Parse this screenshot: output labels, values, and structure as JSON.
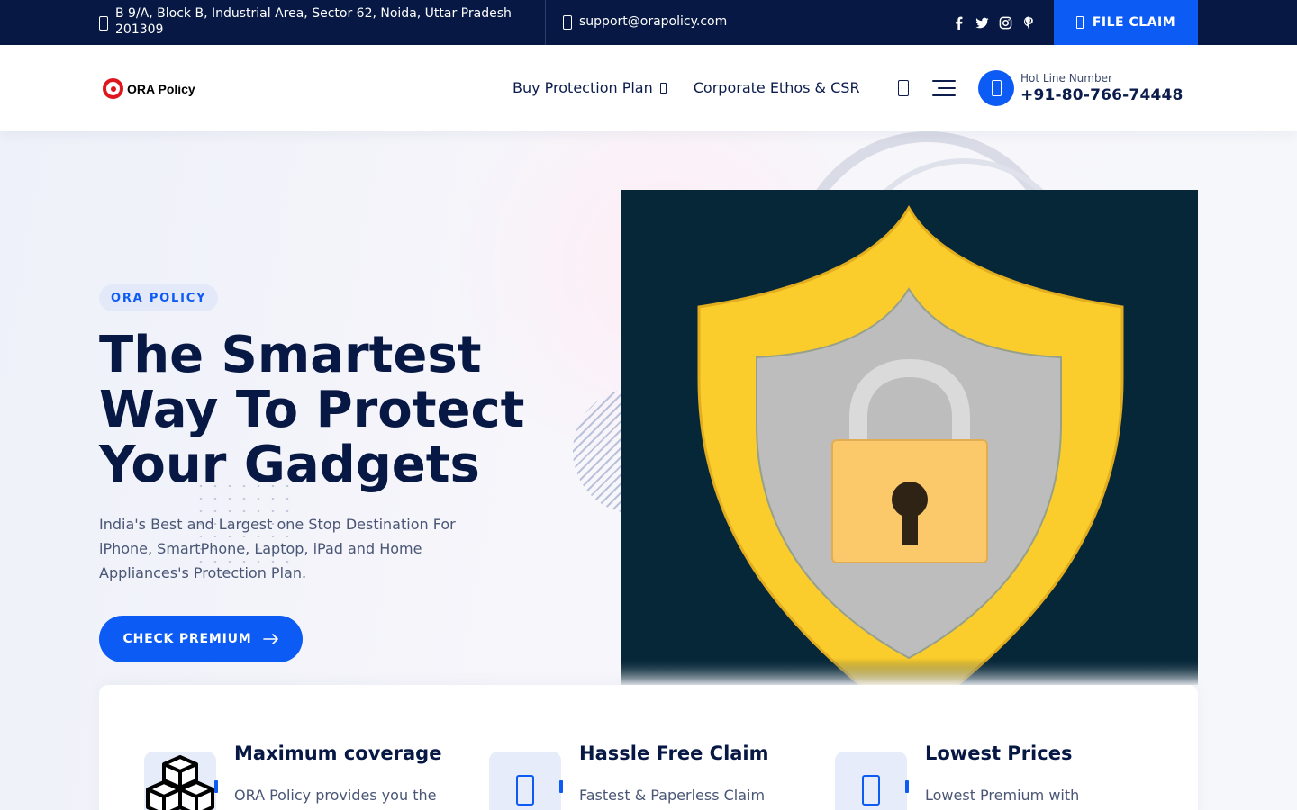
{
  "topbar": {
    "address": "B 9/A, Block B, Industrial Area, Sector 62, Noida, Uttar Pradesh 201309",
    "email": "support@orapolicy.com",
    "socials": [
      "facebook-icon",
      "twitter-icon",
      "instagram-icon",
      "pinterest-icon"
    ],
    "file_claim_label": "FILE CLAIM"
  },
  "header": {
    "logo_text": "ORA Policy",
    "nav": [
      {
        "label": "Buy Protection Plan",
        "has_dropdown": true
      },
      {
        "label": "Corporate Ethos & CSR",
        "has_dropdown": false
      }
    ],
    "hotline_label": "Hot Line Number",
    "hotline_number": "+91-80-766-74448"
  },
  "hero": {
    "badge": "ORA POLICY",
    "title": "The Smartest Way To Protect Your Gadgets",
    "description": "India's Best and Largest one Stop Destination For iPhone, SmartPhone, Laptop, iPad and Home Appliances's Protection Plan.",
    "cta_label": "CHECK PREMIUM",
    "image": "shield-lock-illustration"
  },
  "features": [
    {
      "title": "Maximum coverage",
      "description": "ORA Policy provides you the",
      "icon": "cubes-icon"
    },
    {
      "title": "Hassle Free Claim",
      "description": "Fastest & Paperless Claim",
      "icon": "claim-icon"
    },
    {
      "title": "Lowest Prices",
      "description": "Lowest Premium with",
      "icon": "price-icon"
    }
  ],
  "colors": {
    "navy": "#061843",
    "accent": "#0d5bf5",
    "logo_red": "#e0161e",
    "shield_yellow": "#fbcd2c"
  }
}
